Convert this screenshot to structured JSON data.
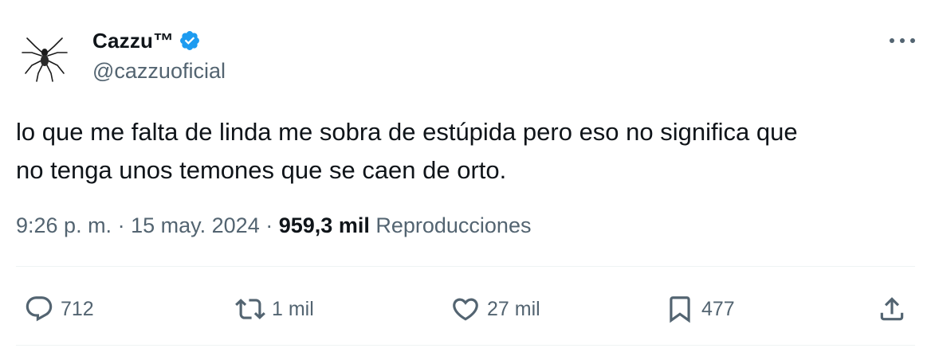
{
  "author": {
    "display_name": "Cazzu™",
    "handle": "@cazzuoficial",
    "verified": true,
    "verified_color": "#1d9bf0",
    "avatar_icon": "spider-icon"
  },
  "more_icon": "more-horizontal-icon",
  "tweet": {
    "text_line1": "lo que me falta de linda me sobra de estúpida pero eso no significa que",
    "text_line2": "no tenga unos temones que se caen de orto."
  },
  "meta": {
    "time": "9:26 p. m.",
    "separator": "·",
    "date": "15 may. 2024",
    "views_count": "959,3 mil",
    "views_label": "Reproducciones"
  },
  "actions": {
    "reply_count": "712",
    "retweet_count": "1 mil",
    "like_count": "27 mil",
    "bookmark_count": "477"
  },
  "colors": {
    "text": "#0f1419",
    "secondary": "#536471",
    "divider": "#eff3f4"
  }
}
